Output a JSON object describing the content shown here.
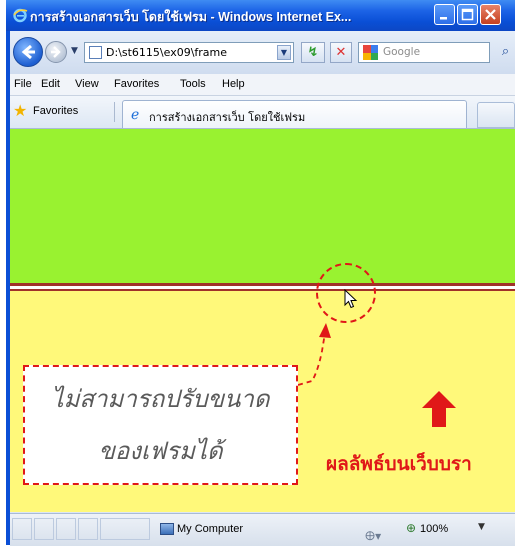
{
  "window": {
    "title": "การสร้างเอกสารเว็บ โดยใช้เฟรม - Windows Internet Ex..."
  },
  "address_bar": {
    "url": "D:\\st6115\\ex09\\frame"
  },
  "search": {
    "placeholder": "Google"
  },
  "menu": {
    "items": [
      "File",
      "Edit",
      "View",
      "Favorites",
      "Tools",
      "Help"
    ]
  },
  "favorites_bar": {
    "favorites_label": "Favorites",
    "tab_title": "การสร้างเอกสารเว็บ โดยใช้เฟรม"
  },
  "content": {
    "top_frame_color": "#99f230",
    "bottom_frame_color": "#fff97a",
    "border_color": "#a0322a",
    "annotation_color": "#e01818",
    "note_line1": "ไม่สามารถปรับขนาด",
    "note_line2": "ของเฟรมได้",
    "result_label": "ผลลัพธ์บนเว็บบรา"
  },
  "status_bar": {
    "zone": "My Computer",
    "zoom": "100%"
  }
}
